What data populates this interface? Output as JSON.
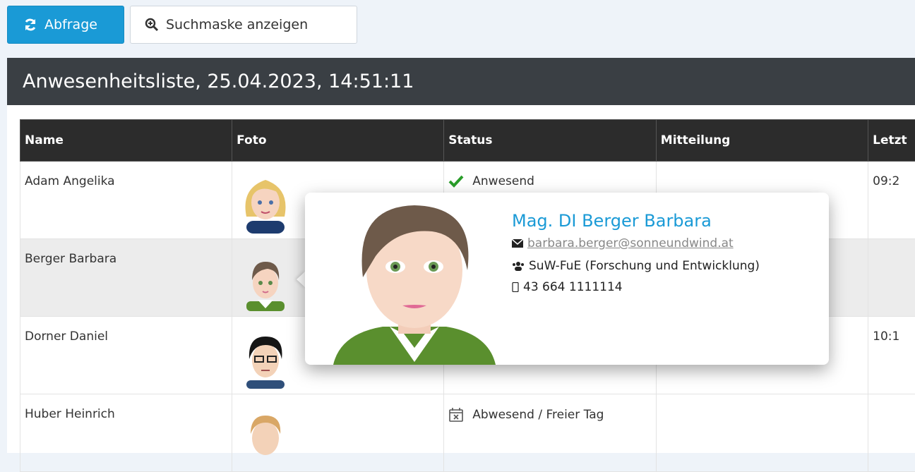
{
  "toolbar": {
    "query_label": "Abfrage",
    "search_mask_label": "Suchmaske anzeigen"
  },
  "panel": {
    "title": "Anwesenheitsliste, 25.04.2023, 14:51:11"
  },
  "table": {
    "headers": [
      "Name",
      "Foto",
      "Status",
      "Mitteilung",
      "Letzt"
    ],
    "rows": [
      {
        "name": "Adam Angelika",
        "status": "Anwesend",
        "message": "",
        "last": "09:2"
      },
      {
        "name": "Berger Barbara",
        "status": "",
        "message": "",
        "last": ""
      },
      {
        "name": "Dorner Daniel",
        "status": "",
        "message": "",
        "last": "10:1"
      },
      {
        "name": "Huber Heinrich",
        "status": "Abwesend / Freier Tag",
        "message": "",
        "last": ""
      }
    ]
  },
  "popover": {
    "full_name": "Mag. DI Berger Barbara",
    "email": "barbara.berger@sonneundwind.at",
    "department": "SuW-FuE (Forschung und Entwicklung)",
    "phone": "43 664 1111114"
  },
  "colors": {
    "primary": "#1a9ad6",
    "header_dark": "#3a3f44",
    "table_header": "#2c2c2c",
    "present_green": "#2a9d2a"
  }
}
